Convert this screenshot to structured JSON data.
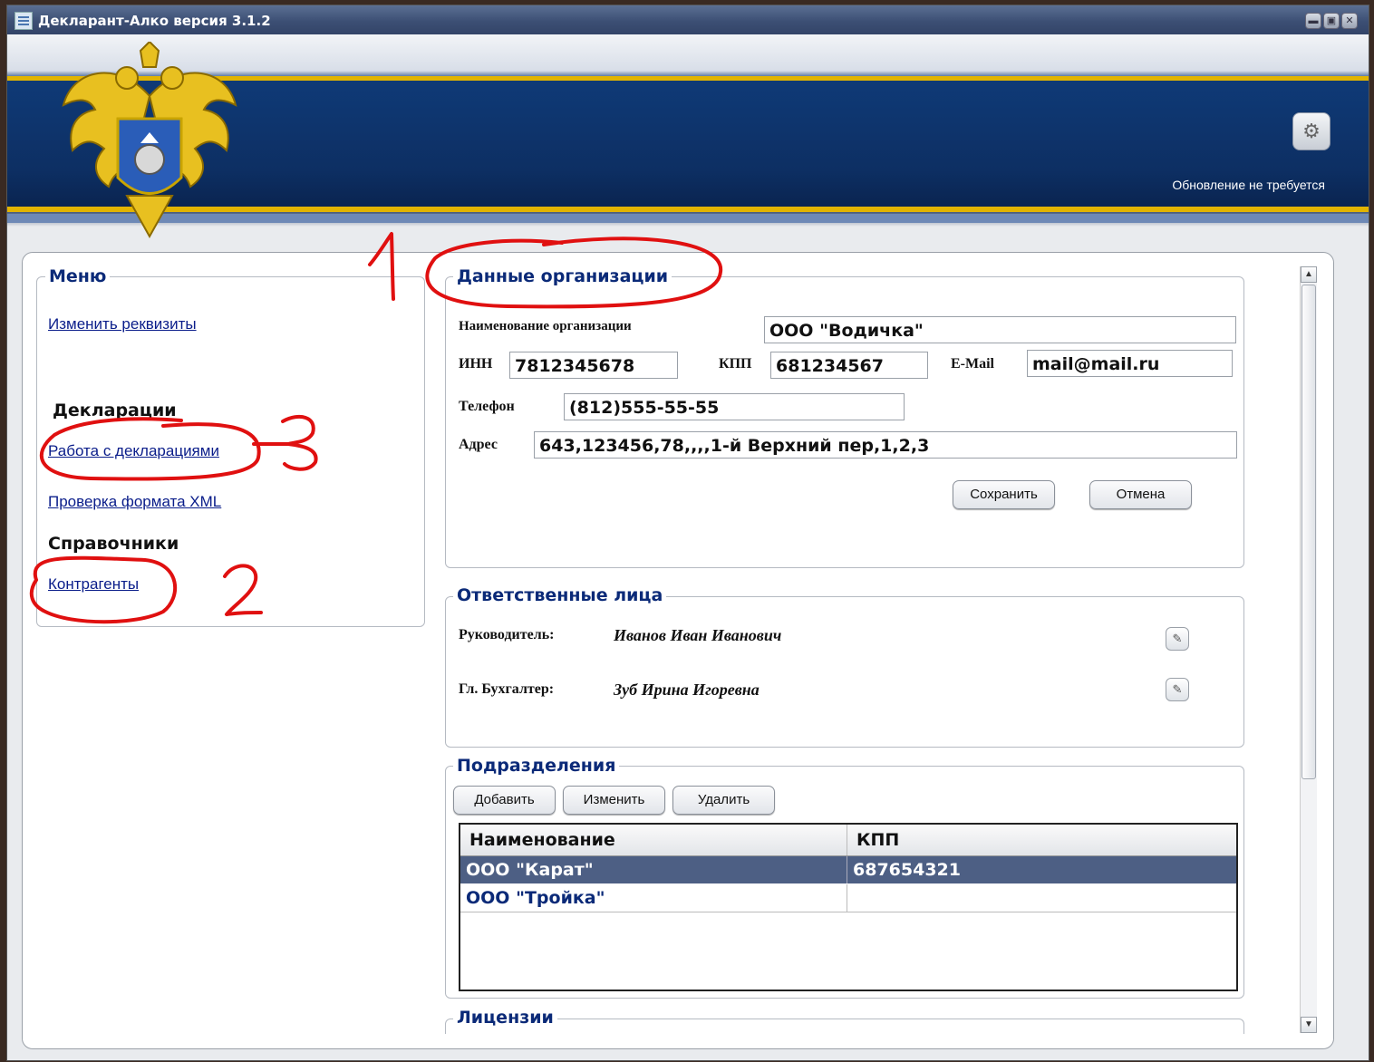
{
  "window": {
    "title": "Декларант-Алко версия 3.1.2"
  },
  "header": {
    "update_status": "Обновление не требуется"
  },
  "menu": {
    "title": "Меню",
    "change_requisites": "Изменить реквизиты",
    "declarations_heading": "Декларации",
    "work_with_declarations": "Работа с декларациями",
    "check_xml": "Проверка формата XML",
    "references_heading": "Справочники",
    "counterparties": "Контрагенты"
  },
  "org": {
    "title": "Данные организации",
    "name_label": "Наименование организации",
    "name_value": "ООО \"Водичка\"",
    "inn_label": "ИНН",
    "inn_value": "7812345678",
    "kpp_label": "КПП",
    "kpp_value": "681234567",
    "email_label": "E-Mail",
    "email_value": "mail@mail.ru",
    "phone_label": "Телефон",
    "phone_value": "(812)555-55-55",
    "address_label": "Адрес",
    "address_value": "643,123456,78,,,,1-й Верхний пер,1,2,3",
    "save_button": "Сохранить",
    "cancel_button": "Отмена"
  },
  "responsible": {
    "title": "Ответственные лица",
    "head_label": "Руководитель:",
    "head_name": "Иванов Иван Иванович",
    "accountant_label": "Гл. Бухгалтер:",
    "accountant_name": "Зуб Ирина Игоревна"
  },
  "divisions": {
    "title": "Подразделения",
    "add_button": "Добавить",
    "edit_button": "Изменить",
    "delete_button": "Удалить",
    "columns": [
      "Наименование",
      "КПП"
    ],
    "rows": [
      {
        "name": "ООО \"Карат\"",
        "kpp": "687654321",
        "selected": true
      },
      {
        "name": "ООО \"Тройка\"",
        "kpp": "",
        "selected": false
      }
    ]
  },
  "licenses": {
    "title": "Лицензии"
  },
  "annotations": {
    "n1": "1",
    "n2": "2",
    "n3": "3",
    "color": "#e01010"
  },
  "colors": {
    "title_bar": "#3c4f74",
    "banner_blue": "#0d2f63",
    "banner_gold": "#e2b400",
    "selected_row": "#4d5f84",
    "group_title": "#0b2a78",
    "link": "#0a1d8a"
  }
}
